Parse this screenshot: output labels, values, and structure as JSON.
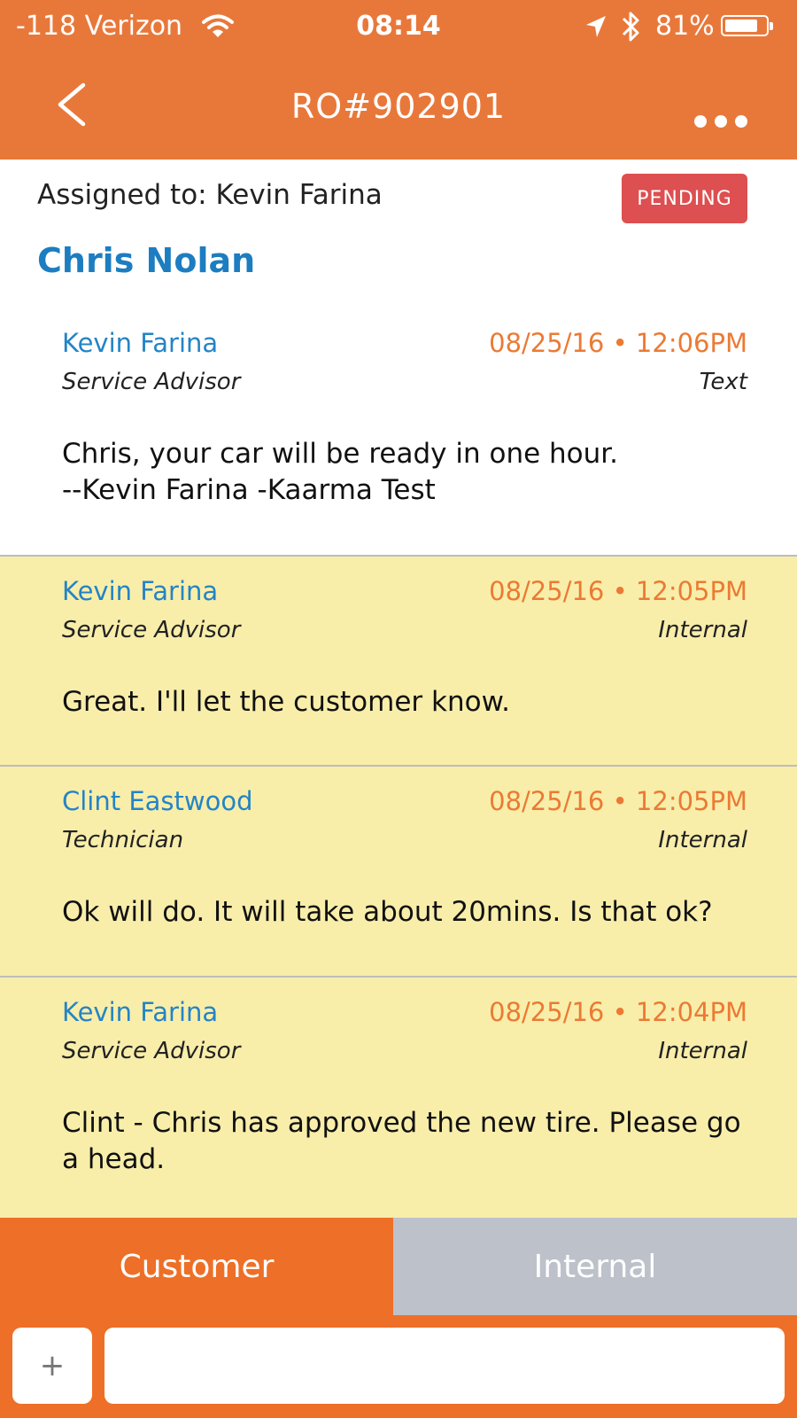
{
  "status_bar": {
    "carrier": "-118 Verizon",
    "time": "08:14",
    "battery_percent": "81%",
    "battery_level": 0.81,
    "icons": [
      "wifi-icon",
      "location-arrow-icon",
      "bluetooth-icon",
      "battery-icon"
    ]
  },
  "nav": {
    "title": "RO#902901",
    "back_icon": "chevron-left-icon",
    "more_icon": "more-dots-icon"
  },
  "header": {
    "assigned_to": "Assigned to: Kevin Farina",
    "status_badge": "PENDING",
    "customer_name": "Chris Nolan"
  },
  "messages": [
    {
      "sender": "Kevin Farina",
      "timestamp": "08/25/16 • 12:06PM",
      "role": "Service Advisor",
      "channel": "Text",
      "body": "Chris, your car will be ready in one hour.\n--Kevin Farina  -Kaarma Test",
      "style": "white"
    },
    {
      "sender": "Kevin Farina",
      "timestamp": "08/25/16 • 12:05PM",
      "role": "Service Advisor",
      "channel": "Internal",
      "body": "Great.  I'll let the customer know.",
      "style": "yellow"
    },
    {
      "sender": "Clint Eastwood",
      "timestamp": "08/25/16 • 12:05PM",
      "role": "Technician",
      "channel": "Internal",
      "body": "Ok will do. It will take about 20mins. Is that ok?",
      "style": "yellow"
    },
    {
      "sender": "Kevin Farina",
      "timestamp": "08/25/16 • 12:04PM",
      "role": "Service Advisor",
      "channel": "Internal",
      "body": "Clint - Chris has approved the new tire.  Please go a head.",
      "style": "yellow"
    }
  ],
  "tabs": {
    "customer": "Customer",
    "internal": "Internal",
    "selected": "Customer"
  },
  "composer": {
    "attach_label": "+",
    "input_value": "",
    "input_placeholder": ""
  },
  "colors": {
    "brand_orange": "#E8783A",
    "tab_orange": "#EE6F27",
    "badge_red": "#DD4F50",
    "name_blue": "#1C7DC0",
    "internal_yellow": "#F8EEAA"
  }
}
